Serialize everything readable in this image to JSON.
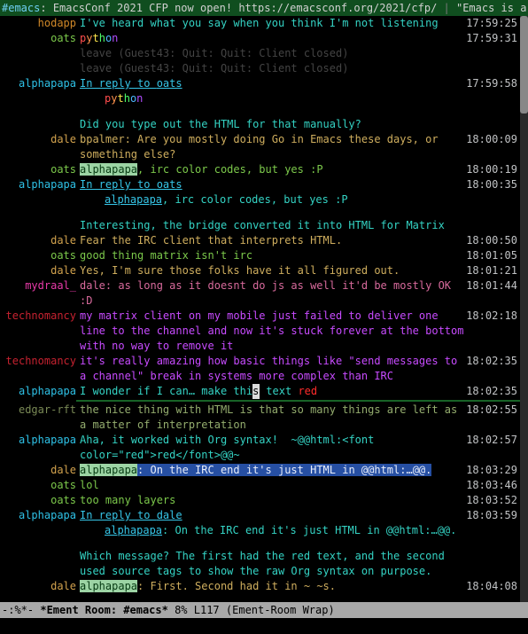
{
  "header": {
    "room": "#emacs",
    "sep1": ": ",
    "topic": "EmacsConf 2021 CFP now open! https://emacsconf.org/2021/cfp/",
    "sep2": " | ",
    "tail": "\"Emacs is a co"
  },
  "nicks": {
    "hodapp": "hodapp",
    "oats": "oats",
    "alphapapa": "alphapapa",
    "dale": "dale",
    "mydraal": "mydraal_",
    "technomancy": "technomancy",
    "edgar": "edgar-rft"
  },
  "python_chars": [
    "p",
    "y",
    "t",
    "h",
    "o",
    "n"
  ],
  "msgs": {
    "hodapp1": "I've heard what you say when you think I'm not listening",
    "leave1": "leave (Guest43: Quit: Quit: Client closed)",
    "leave2": "leave (Guest43: Quit: Quit: Client closed)",
    "reply_to": "In reply to ",
    "oats_link": "oats",
    "alpha_q1": "Did you type out the HTML for that manually?",
    "dale_q1": "bpalmer: Are you mostly doing Go in Emacs these days, or something else?",
    "oats_hl": "alphapapa",
    "oats_hl_tail": ", irc color codes, but yes :P",
    "alpha_link2": "alphapapa",
    "alpha_reply_tail": ", irc color codes, but yes :P",
    "alpha_bridge": "Interesting, the bridge converted it into HTML for Matrix",
    "dale_fear": "Fear the IRC client that interprets HTML.",
    "oats_good": "good thing matrix isn't irc",
    "dale_yes": "Yes, I'm sure those folks have it all figured out.",
    "mydraal": "dale: as long as it doesnt do js as well it'd be mostly OK :D",
    "techno1": "my matrix client on my mobile just failed to deliver one line to the channel and now it's stuck forever at the bottom with no way to remove it",
    "techno2": "it's really amazing how basic things like \"send messages to a channel\" break in systems more complex than IRC",
    "wonder_a": "I wonder if I can… make thi",
    "wonder_cursor": "s",
    "wonder_b": " text ",
    "wonder_red": "red",
    "edgar": "the nice thing with HTML is that so many things are left as a matter of interpretation",
    "alpha_org_a": "Aha, it worked with Org syntax!  ~",
    "alpha_org_b": "@@html:<font color=\"red\">red</font>@@",
    "alpha_org_c": "~",
    "dale_hl1": ": On the IRC end it's just HTML in @@html:…@@.",
    "oats_lol": "lol",
    "oats_tml": "too many layers",
    "dale_link": "dale",
    "alpha_reply2_tail": ": On the IRC end it's just HTML in @@html:…@@.",
    "alpha_which": "Which message? The first had the red text, and the second used source tags to show the raw Org syntax on purpose.",
    "dale_first": ": First. Second had it in ~ ~s."
  },
  "times": {
    "t1": "17:59:25",
    "t2": "17:59:31",
    "t3": "17:59:58",
    "t4": "18:00:09",
    "t5": "18:00:19",
    "t6": "18:00:35",
    "t7": "18:00:50",
    "t8": "18:01:05",
    "t9": "18:01:21",
    "t10": "18:01:44",
    "t11": "18:02:18",
    "t12": "18:02:35",
    "t13": "18:02:35",
    "t14": "18:02:55",
    "t15": "18:02:57",
    "t16": "18:03:29",
    "t17": "18:03:46",
    "t18": "18:03:52",
    "t19": "18:03:59",
    "t20": "18:04:08"
  },
  "modeline": {
    "left": "-:%*-  ",
    "buf": "*Ement Room: #emacs*",
    "pos": "   8% L117    ",
    "mode": "(Ement-Room Wrap)"
  }
}
